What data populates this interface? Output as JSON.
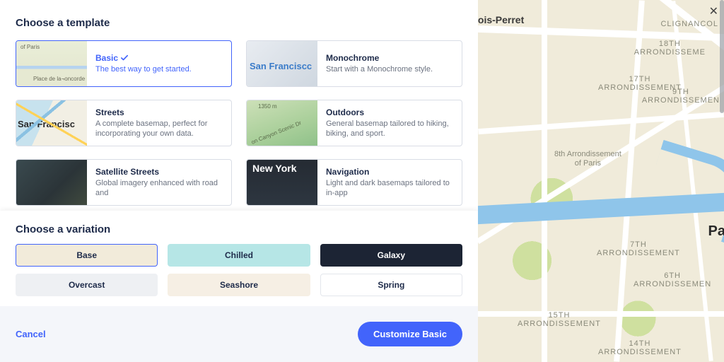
{
  "section_templates_title": "Choose a template",
  "section_variations_title": "Choose a variation",
  "templates": [
    {
      "name": "Basic",
      "desc": "The best way to get started.",
      "selected": true,
      "thumb": "th-basic"
    },
    {
      "name": "Monochrome",
      "desc": "Start with a Monochrome style.",
      "selected": false,
      "thumb": "th-mono"
    },
    {
      "name": "Streets",
      "desc": "A complete basemap, perfect for incorporating your own data.",
      "selected": false,
      "thumb": "th-streets"
    },
    {
      "name": "Outdoors",
      "desc": "General basemap tailored to hiking, biking, and sport.",
      "selected": false,
      "thumb": "th-outdoors"
    },
    {
      "name": "Satellite Streets",
      "desc": "Global imagery enhanced with road and",
      "selected": false,
      "thumb": "th-sat"
    },
    {
      "name": "Navigation",
      "desc": "Light and dark basemaps tailored to in-app",
      "selected": false,
      "thumb": "th-nav"
    }
  ],
  "variations": [
    {
      "label": "Base",
      "style": "var-base",
      "selected": true
    },
    {
      "label": "Chilled",
      "style": "var-chilled",
      "selected": false
    },
    {
      "label": "Galaxy",
      "style": "var-galaxy",
      "selected": false
    },
    {
      "label": "Overcast",
      "style": "var-overcast",
      "selected": false
    },
    {
      "label": "Seashore",
      "style": "var-seashore",
      "selected": false
    },
    {
      "label": "Spring",
      "style": "var-spring",
      "selected": false
    }
  ],
  "footer": {
    "cancel": "Cancel",
    "cta": "Customize Basic"
  },
  "map": {
    "big_label": "lois-Perret",
    "place_label": "Pa",
    "arrondissements": {
      "clig": "CLIGNANCOL",
      "a18": "18TH\nARRONDISSEME",
      "a17": "17TH\nARRONDISSEMENT",
      "a9": "9TH\nARRONDISSEMEN",
      "a8": "8th Arrondissement\nof Paris",
      "a7": "7TH\nARRONDISSEMENT",
      "a6": "6TH\nARRONDISSEMEN",
      "a15": "15TH\nARRONDISSEMENT",
      "a14": "14TH\nARRONDISSEMENT"
    }
  },
  "colors": {
    "accent": "#4264fb"
  }
}
